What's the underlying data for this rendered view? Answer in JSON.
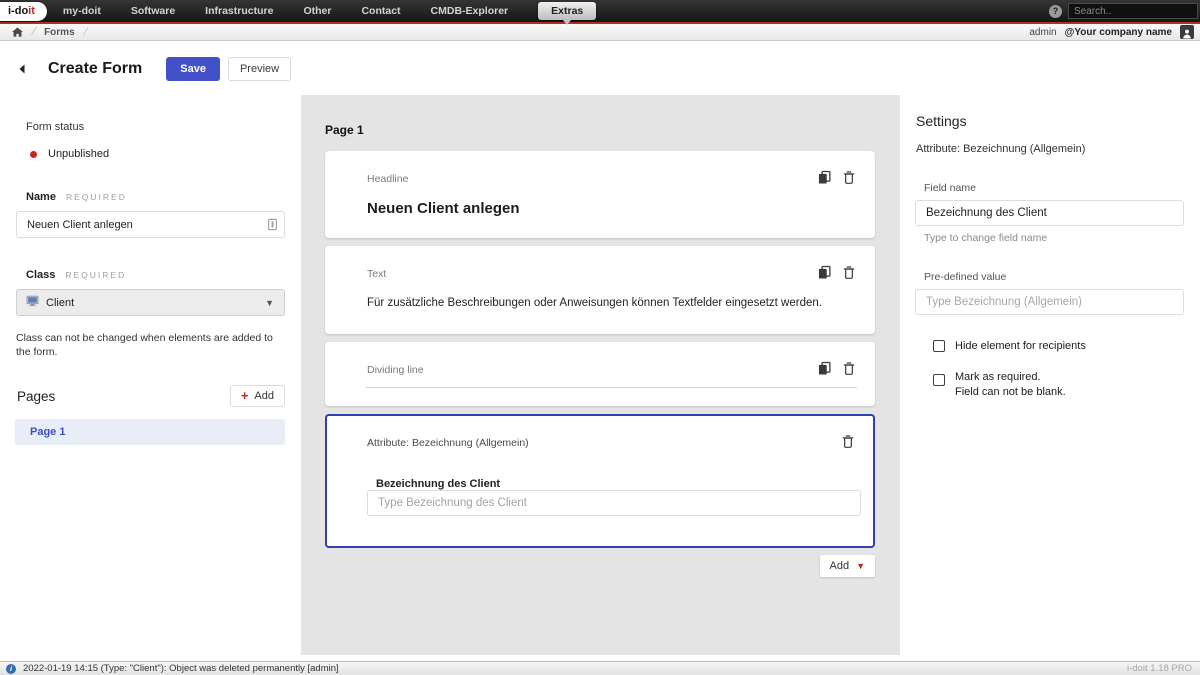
{
  "topnav": {
    "logo": "i-doit",
    "items": [
      "my-doit",
      "Software",
      "Infrastructure",
      "Other",
      "Contact",
      "CMDB-Explorer",
      "Extras"
    ],
    "active_item": "Extras",
    "help_glyph": "?",
    "search_placeholder": "Search.."
  },
  "breadcrumb": {
    "path": "Forms",
    "user": "admin",
    "company": "@Your company name"
  },
  "header": {
    "title": "Create Form",
    "save_label": "Save",
    "preview_label": "Preview"
  },
  "sidebar": {
    "form_status_label": "Form status",
    "status_value": "Unpublished",
    "name_label": "Name",
    "required_label": "REQUIRED",
    "name_value": "Neuen Client anlegen",
    "class_label": "Class",
    "class_value": "Client",
    "class_note": "Class can not be changed when elements are added to the form.",
    "pages_label": "Pages",
    "add_label": "Add",
    "pages": [
      {
        "label": "Page 1"
      }
    ]
  },
  "canvas": {
    "page_title": "Page 1",
    "elements": [
      {
        "type_label": "Headline",
        "content": "Neuen Client anlegen"
      },
      {
        "type_label": "Text",
        "content": "Für zusätzliche Beschreibungen oder Anweisungen können Textfelder eingesetzt werden."
      },
      {
        "type_label": "Dividing line"
      },
      {
        "type_label": "Attribute: Bezeichnung (Allgemein)",
        "field_label": "Bezeichnung des Client",
        "placeholder": "Type Bezeichnung des Client"
      }
    ],
    "add_label": "Add"
  },
  "settings": {
    "title": "Settings",
    "subtitle": "Attribute: Bezeichnung (Allgemein)",
    "field_name_label": "Field name",
    "field_name_value": "Bezeichnung des Client",
    "field_name_help": "Type to change field name",
    "predefined_label": "Pre-defined value",
    "predefined_placeholder": "Type Bezeichnung (Allgemein)",
    "checkbox_hide_label": "Hide element for recipients",
    "checkbox_required_line1": "Mark as required.",
    "checkbox_required_line2": "Field can not be blank."
  },
  "statusbar": {
    "message": "2022-01-19 14:15 (Type: \"Client\"): Object was deleted permanently [admin]",
    "version": "i-doit 1.18 PRO"
  },
  "colors": {
    "accent_blue": "#4351c8",
    "selected_card_border": "#2e3fae",
    "brand_red": "#c0281e",
    "topbar_red_line": "#a93527",
    "status_unpublished_red": "#d21f1f",
    "page_item_bg": "#e8edf8",
    "page_item_text": "#3b50c4"
  }
}
